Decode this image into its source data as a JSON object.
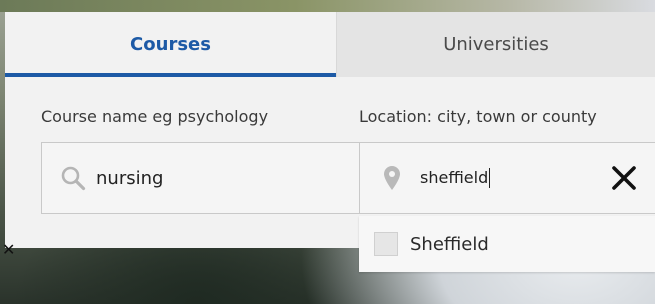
{
  "tabs": [
    {
      "label": "Courses",
      "active": true
    },
    {
      "label": "Universities",
      "active": false
    }
  ],
  "course_field": {
    "label": "Course name eg psychology",
    "value": "nursing",
    "icon": "search-icon"
  },
  "location_field": {
    "label": "Location: city, town or county",
    "value": "sheffield",
    "icon": "location-pin-icon",
    "clear_icon": "close-icon"
  },
  "suggestions": [
    {
      "label": "Sheffield",
      "checked": false
    }
  ],
  "colors": {
    "accent": "#1d5aa6",
    "panel": "#f2f2f2",
    "inactive_tab": "#e4e4e4"
  }
}
